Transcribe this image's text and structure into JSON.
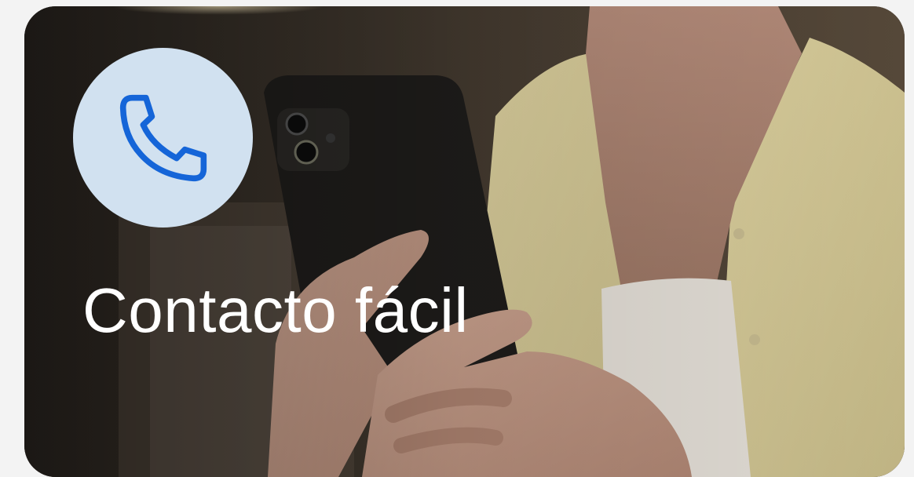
{
  "card": {
    "title": "Contacto fácil",
    "icon": "phone-icon",
    "image": "woman-holding-phone-photo"
  },
  "colors": {
    "icon_circle": "#d1e1f0",
    "icon_stroke": "#1565d8",
    "title_text": "#ffffff",
    "page_background": "#f3f3f3"
  }
}
